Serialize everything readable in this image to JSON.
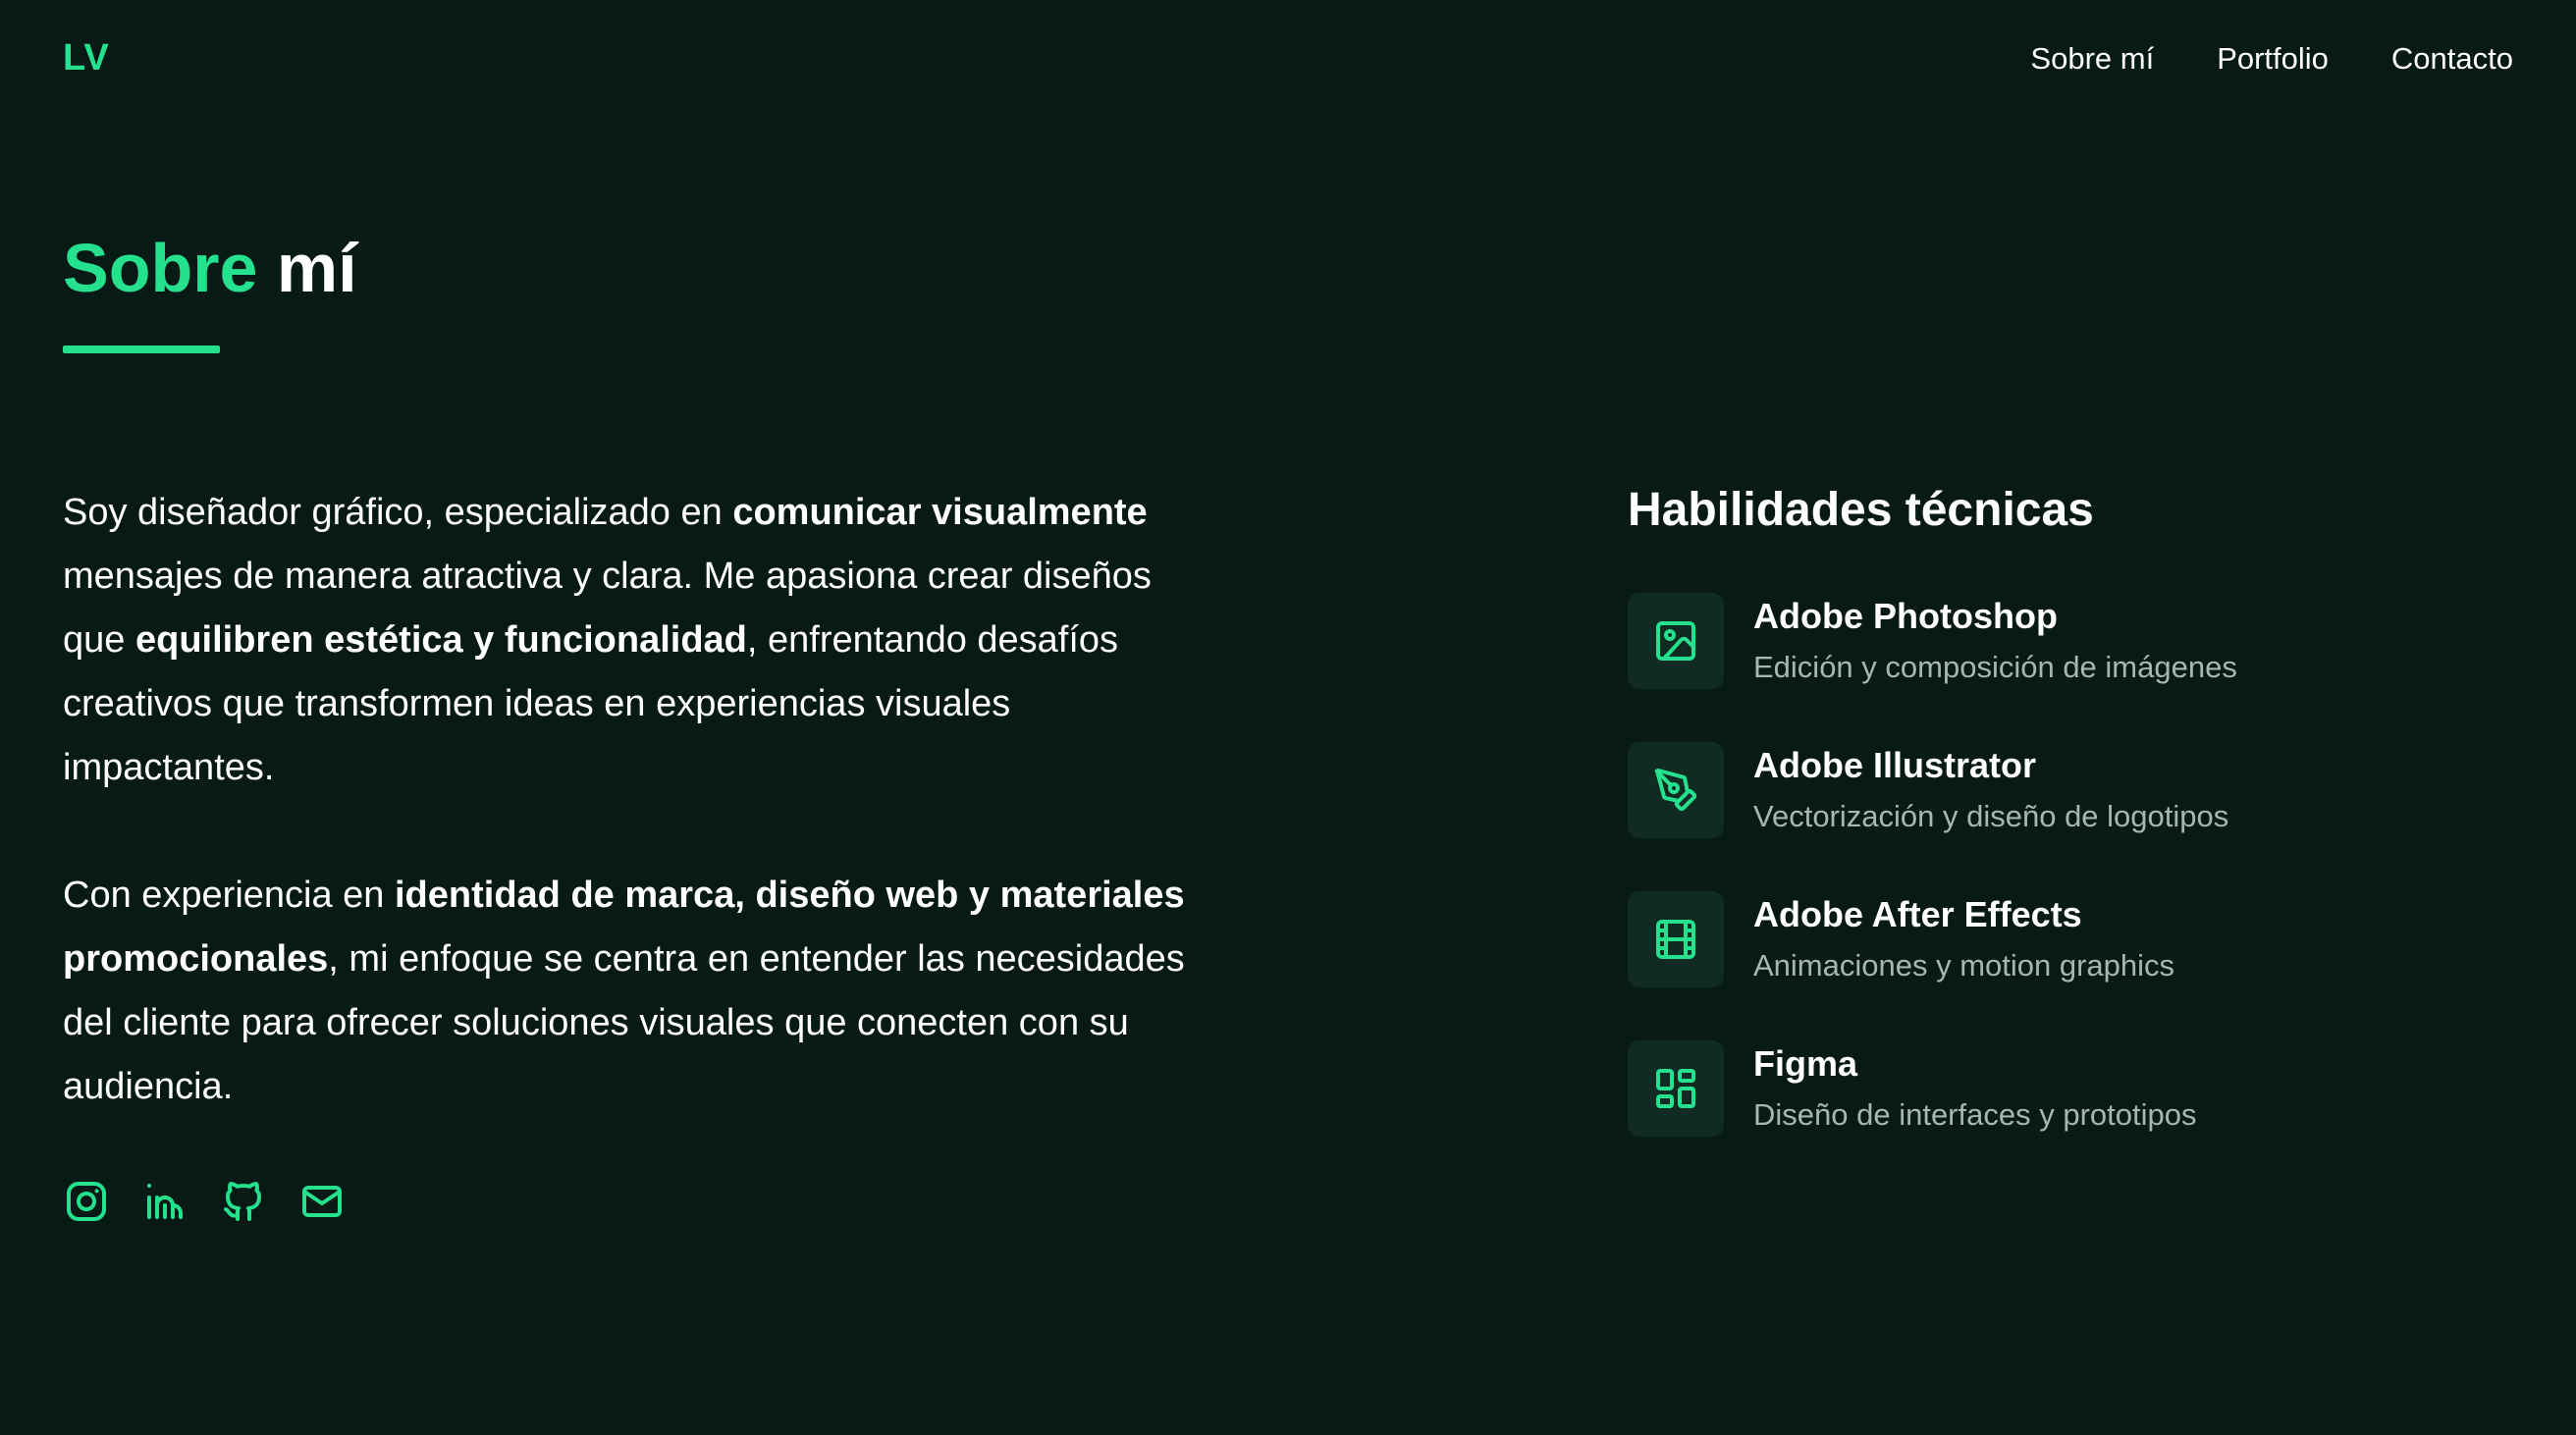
{
  "header": {
    "logo": "LV",
    "nav": [
      "Sobre mí",
      "Portfolio",
      "Contacto"
    ]
  },
  "section": {
    "title_accent": "Sobre",
    "title_rest": "mí"
  },
  "bio": {
    "p1": [
      {
        "t": "Soy diseñador gráfico, especializado en ",
        "b": false
      },
      {
        "t": "comunicar visualmente",
        "b": true
      },
      {
        "t": " mensajes de manera atractiva y clara. Me apasiona crear diseños que ",
        "b": false
      },
      {
        "t": "equilibren estética y funcionalidad",
        "b": true
      },
      {
        "t": ", enfrentando desafíos creativos que transformen ideas en experiencias visuales impactantes.",
        "b": false
      }
    ],
    "p2": [
      {
        "t": "Con experiencia en ",
        "b": false
      },
      {
        "t": "identidad de marca, diseño web y materiales promocionales",
        "b": true
      },
      {
        "t": ", mi enfoque se centra en entender las necesidades del cliente para ofrecer soluciones visuales que conecten con su audiencia.",
        "b": false
      }
    ]
  },
  "social": [
    {
      "name": "instagram-icon"
    },
    {
      "name": "linkedin-icon"
    },
    {
      "name": "github-icon"
    },
    {
      "name": "mail-icon"
    }
  ],
  "skills": {
    "title": "Habilidades técnicas",
    "items": [
      {
        "name": "Adobe Photoshop",
        "desc": "Edición y composición de imágenes",
        "icon": "image-icon"
      },
      {
        "name": "Adobe Illustrator",
        "desc": "Vectorización y diseño de logotipos",
        "icon": "pen-tool-icon"
      },
      {
        "name": "Adobe After Effects",
        "desc": "Animaciones y motion graphics",
        "icon": "film-icon"
      },
      {
        "name": "Figma",
        "desc": "Diseño de interfaces y prototipos",
        "icon": "layout-grid-icon"
      }
    ]
  },
  "colors": {
    "background": "#081a16",
    "accent": "#25e08d",
    "icon_tile": "#0f2b22",
    "muted_text": "#a9b5b1"
  }
}
